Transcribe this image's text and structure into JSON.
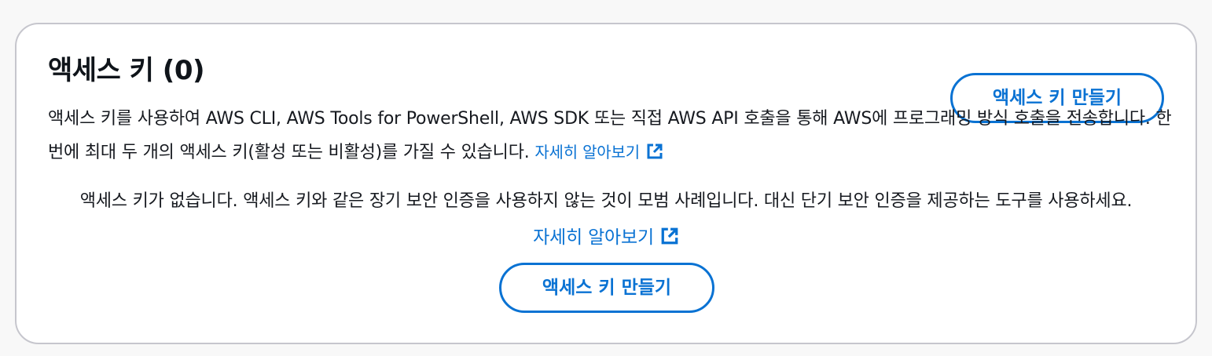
{
  "panel": {
    "title": "액세스 키 (0)",
    "create_button_label": "액세스 키 만들기",
    "description": "액세스 키를 사용하여 AWS CLI, AWS Tools for PowerShell, AWS SDK 또는 직접 AWS API 호출을 통해 AWS에 프로그래밍 방식 호출을 전송합니다. 한 번에 최대 두 개의 액세스 키(활성 또는 비활성)를 가질 수 있습니다.",
    "description_link": "자세히 알아보기",
    "empty_state": {
      "message": "액세스 키가 없습니다. 액세스 키와 같은 장기 보안 인증을 사용하지 않는 것이 모범 사례입니다. 대신 단기 보안 인증을 제공하는 도구를 사용하세요.",
      "link": "자세히 알아보기",
      "create_button_label": "액세스 키 만들기"
    }
  },
  "icons": {
    "external_link": "external-link-icon"
  },
  "colors": {
    "accent": "#0972d3",
    "border": "#c6c6cd",
    "text": "#16191f",
    "background": "#ffffff"
  }
}
